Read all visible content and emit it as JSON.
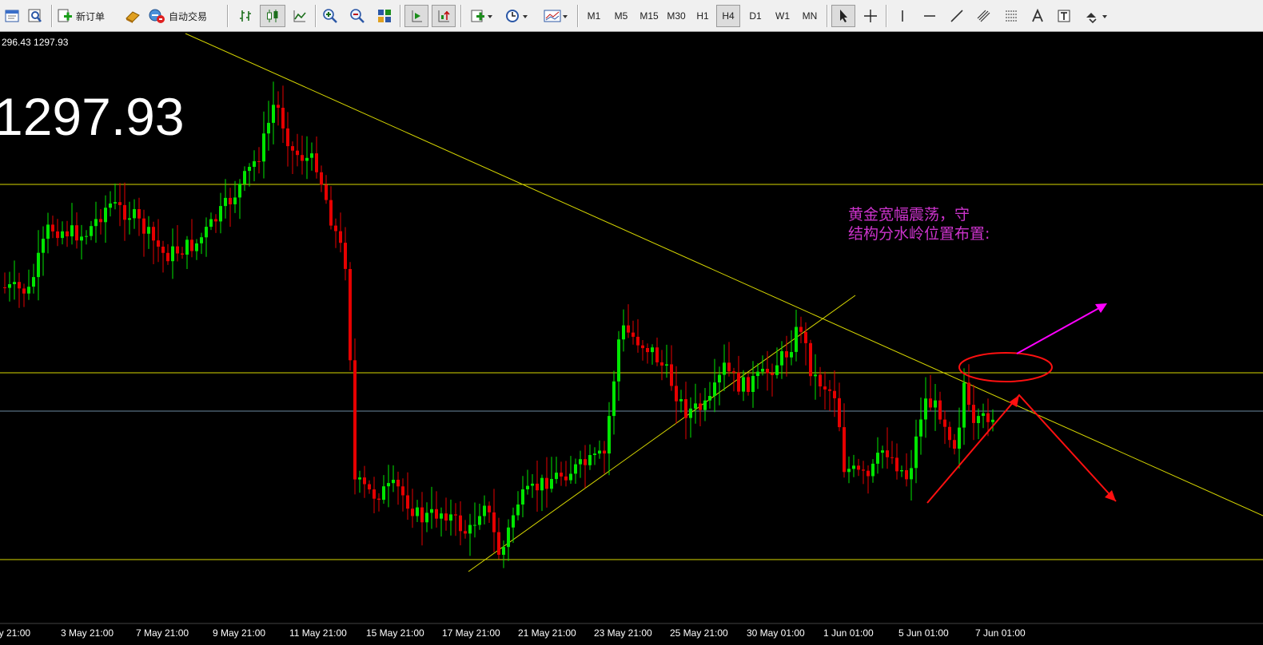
{
  "toolbar": {
    "new_order_label": "新订单",
    "auto_trade_label": "自动交易",
    "timeframes": [
      "M1",
      "M5",
      "M15",
      "M30",
      "H1",
      "H4",
      "D1",
      "W1",
      "MN"
    ],
    "active_timeframe": "H4",
    "icons": [
      "chart-window-icon",
      "zoom-window-icon",
      "new-order-icon",
      "market-watch-icon",
      "auto-trading-icon",
      "bar-chart-icon",
      "candlestick-icon",
      "line-chart-icon",
      "zoom-in-icon",
      "zoom-out-icon",
      "tile-windows-icon",
      "auto-scroll-icon",
      "chart-shift-icon",
      "indicators-icon",
      "periods-icon",
      "templates-icon",
      "cursor-icon",
      "crosshair-icon",
      "vertical-line-icon",
      "horizontal-line-icon",
      "trendline-icon",
      "equidistant-channel-icon",
      "fibonacci-icon",
      "text-icon",
      "text-label-icon",
      "arrows-icon"
    ]
  },
  "chart": {
    "bid_ask": "296.43 1297.93",
    "big_price": "1297.93",
    "annotation_line1": "黄金宽幅震荡，守",
    "annotation_line2": "结构分水岭位置布置:",
    "colors": {
      "background": "#000000",
      "bull": "#00e600",
      "bear": "#e60000",
      "trendline": "#d7d700",
      "level": "#d7d700",
      "bid_line": "#6d8aa0",
      "annotation": "#cc33cc",
      "up_arrow": "#ff00ff",
      "red_marks": "#ff1010"
    }
  },
  "chart_data": {
    "type": "candlestick",
    "timeframe": "H4",
    "x_tick_labels": [
      "ay 21:00",
      "3 May 21:00",
      "7 May 21:00",
      "9 May 21:00",
      "11 May 21:00",
      "15 May 21:00",
      "17 May 21:00",
      "21 May 21:00",
      "23 May 21:00",
      "25 May 21:00",
      "30 May 01:00",
      "1 Jun 01:00",
      "5 Jun 01:00",
      "7 Jun 01:00"
    ],
    "current_price": 1297.93
  }
}
